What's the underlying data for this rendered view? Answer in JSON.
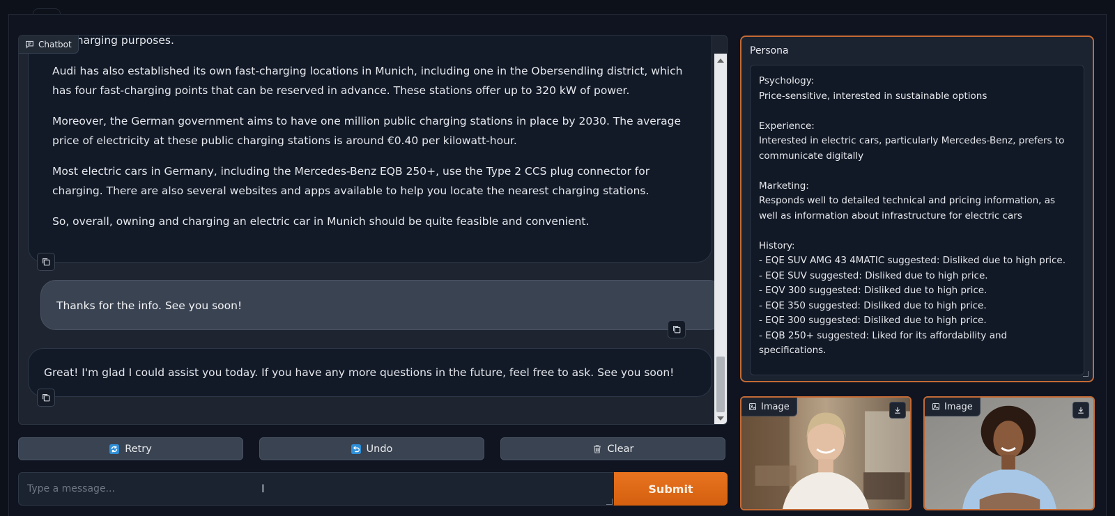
{
  "chatbot": {
    "label": "Chatbot",
    "messages": [
      {
        "role": "bot",
        "paragraphs": [
          "for charging purposes.",
          "Audi has also established its own fast-charging locations in Munich, including one in the Obersendling district, which has four fast-charging points that can be reserved in advance. These stations offer up to 320 kW of power.",
          "Moreover, the German government aims to have one million public charging stations in place by 2030. The average price of electricity at these public charging stations is around €0.40 per kilowatt-hour.",
          "Most electric cars in Germany, including the Mercedes-Benz EQB 250+, use the Type 2 CCS plug connector for charging. There are also several websites and apps available to help you locate the nearest charging stations.",
          "So, overall, owning and charging an electric car in Munich should be quite feasible and convenient."
        ]
      },
      {
        "role": "user",
        "text": "Thanks for the info. See you soon!"
      },
      {
        "role": "bot",
        "text": "Great! I'm glad I could assist you today. If you have any more questions in the future, feel free to ask. See you soon!"
      }
    ]
  },
  "actions": {
    "retry": "Retry",
    "undo": "Undo",
    "clear": "Clear"
  },
  "input": {
    "placeholder": "Type a message...",
    "submit": "Submit"
  },
  "persona": {
    "label": "Persona",
    "text": "Psychology:\nPrice-sensitive, interested in sustainable options\n\nExperience:\nInterested in electric cars, particularly Mercedes-Benz, prefers to communicate digitally\n\nMarketing:\nResponds well to detailed technical and pricing information, as well as information about infrastructure for electric cars\n\nHistory:\n- EQE SUV AMG 43 4MATIC suggested: Disliked due to high price.\n- EQE SUV suggested: Disliked due to high price.\n- EQV 300 suggested: Disliked due to high price.\n- EQE 350 suggested: Disliked due to high price.\n- EQE 300 suggested: Disliked due to high price.\n- EQB 250+ suggested: Liked for its affordability and specifications."
  },
  "images": [
    {
      "label": "Image"
    },
    {
      "label": "Image"
    }
  ],
  "colors": {
    "accent": "#e8731f",
    "border_accent": "#c46a35"
  }
}
